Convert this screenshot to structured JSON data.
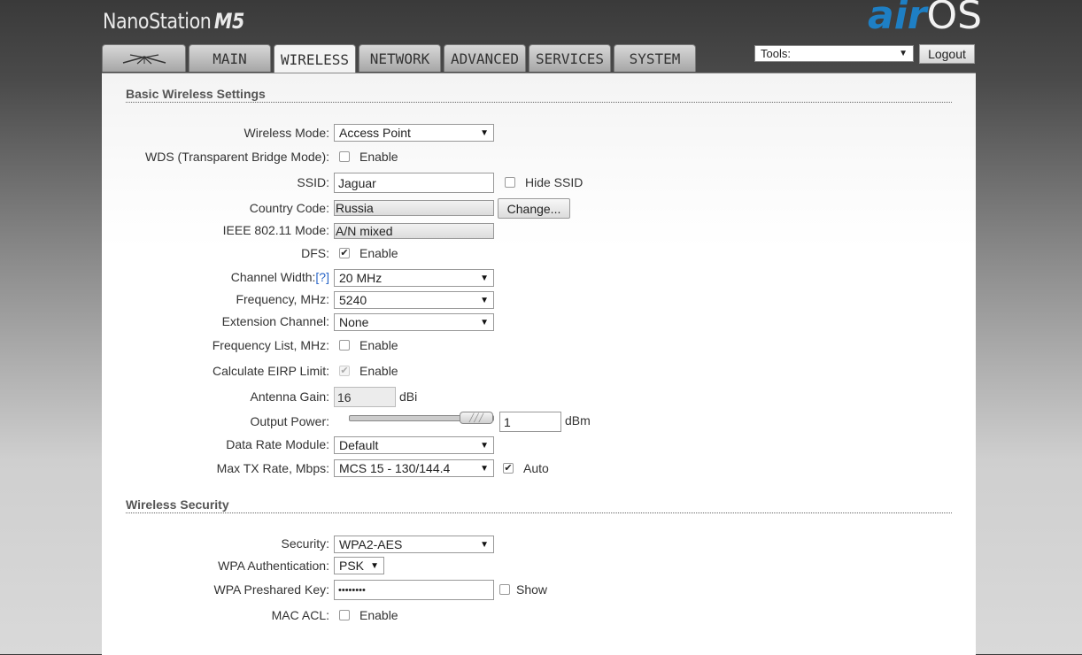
{
  "header": {
    "product": "NanoStation",
    "model": "M5",
    "logo_air": "air",
    "logo_os": "OS"
  },
  "tabs": [
    {
      "label": "",
      "icon": "ubiquiti-logo-icon"
    },
    {
      "label": "MAIN"
    },
    {
      "label": "WIRELESS"
    },
    {
      "label": "NETWORK"
    },
    {
      "label": "ADVANCED"
    },
    {
      "label": "SERVICES"
    },
    {
      "label": "SYSTEM"
    }
  ],
  "tools": {
    "value": "Tools:"
  },
  "logout_label": "Logout",
  "basic": {
    "title": "Basic Wireless Settings",
    "wireless_mode": {
      "label": "Wireless Mode:",
      "value": "Access Point"
    },
    "wds": {
      "label": "WDS (Transparent Bridge Mode):",
      "option": "Enable",
      "checked": false
    },
    "ssid": {
      "label": "SSID:",
      "value": "Jaguar",
      "hide_label": "Hide SSID",
      "hide_checked": false
    },
    "country": {
      "label": "Country Code:",
      "value": "Russia",
      "button": "Change..."
    },
    "ieee": {
      "label": "IEEE 802.11 Mode:",
      "value": "A/N mixed"
    },
    "dfs": {
      "label": "DFS:",
      "option": "Enable",
      "checked": true
    },
    "channel_width": {
      "label": "Channel Width:",
      "help": "[?]",
      "value": "20 MHz"
    },
    "frequency": {
      "label": "Frequency, MHz:",
      "value": "5240"
    },
    "extension_channel": {
      "label": "Extension Channel:",
      "value": "None"
    },
    "frequency_list": {
      "label": "Frequency List, MHz:",
      "option": "Enable",
      "checked": false
    },
    "eirp": {
      "label": "Calculate EIRP Limit:",
      "option": "Enable",
      "checked": true,
      "disabled": true
    },
    "antenna_gain": {
      "label": "Antenna Gain:",
      "value": "16",
      "unit": "dBi"
    },
    "output_power": {
      "label": "Output Power:",
      "value": "1",
      "unit": "dBm",
      "slider_level": 1.0
    },
    "data_rate_module": {
      "label": "Data Rate Module:",
      "value": "Default"
    },
    "max_tx_rate": {
      "label": "Max TX Rate, Mbps:",
      "value": "MCS 15 - 130/144.4",
      "auto_label": "Auto",
      "auto_checked": true
    }
  },
  "security": {
    "title": "Wireless Security",
    "security": {
      "label": "Security:",
      "value": "WPA2-AES"
    },
    "wpa_auth": {
      "label": "WPA Authentication:",
      "value": "PSK"
    },
    "preshared_key": {
      "label": "WPA Preshared Key:",
      "value": "••••••••",
      "show_label": "Show",
      "show_checked": false
    },
    "mac_acl": {
      "label": "MAC ACL:",
      "option": "Enable",
      "checked": false
    }
  }
}
